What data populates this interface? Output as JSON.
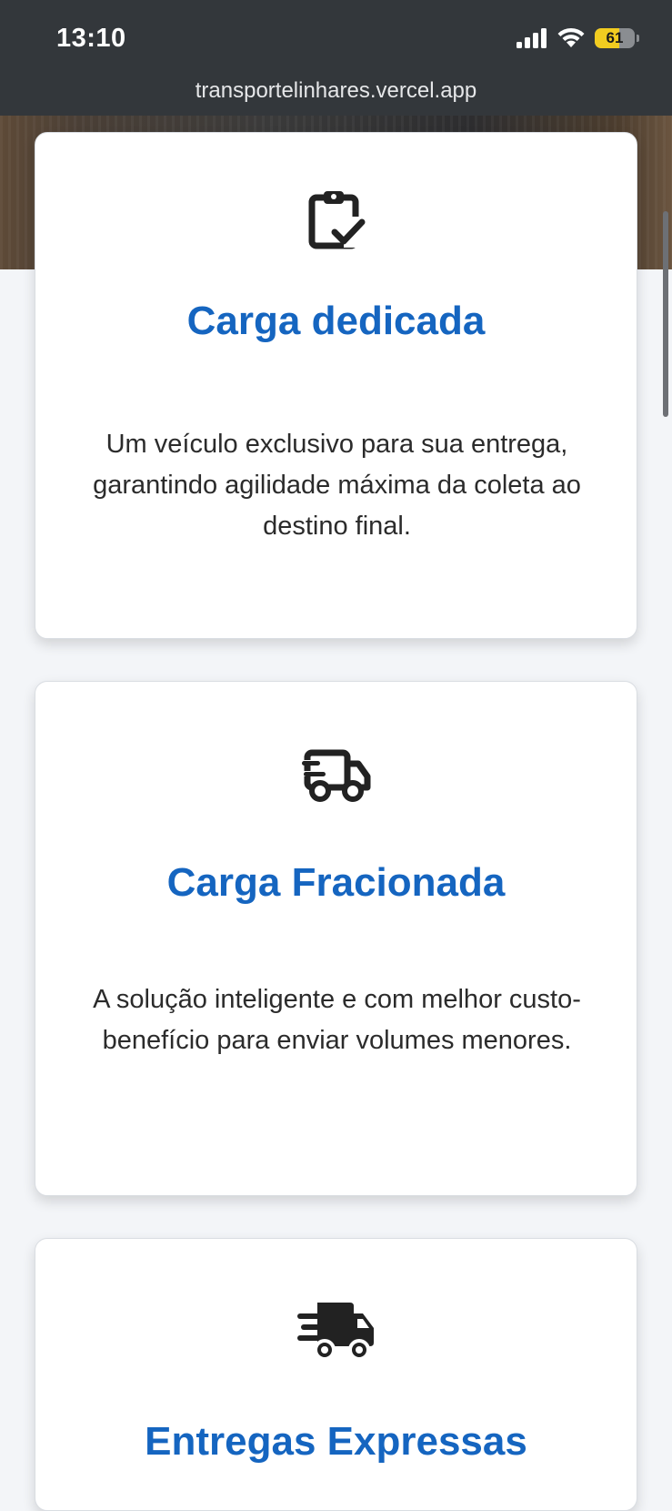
{
  "status_bar": {
    "time": "13:10",
    "battery_level": "61",
    "battery_fraction": 0.61,
    "icons": [
      "cellular-signal-icon",
      "wifi-icon",
      "battery-icon"
    ]
  },
  "browser": {
    "url": "transportelinhares.vercel.app"
  },
  "colors": {
    "accent": "#1565c0",
    "topbar": "#33373b",
    "battery": "#f2cc20"
  },
  "services": [
    {
      "icon": "clipboard-check-icon",
      "title": "Carga dedicada",
      "description": "Um veículo exclusivo para sua entrega, garantindo agilidade máxima da coleta ao destino final."
    },
    {
      "icon": "truck-icon",
      "title": "Carga Fracionada",
      "description": "A solução inteligente e com melhor custo-benefício para enviar volumes menores."
    },
    {
      "icon": "fast-truck-icon",
      "title": "Entregas Expressas",
      "description": ""
    }
  ]
}
